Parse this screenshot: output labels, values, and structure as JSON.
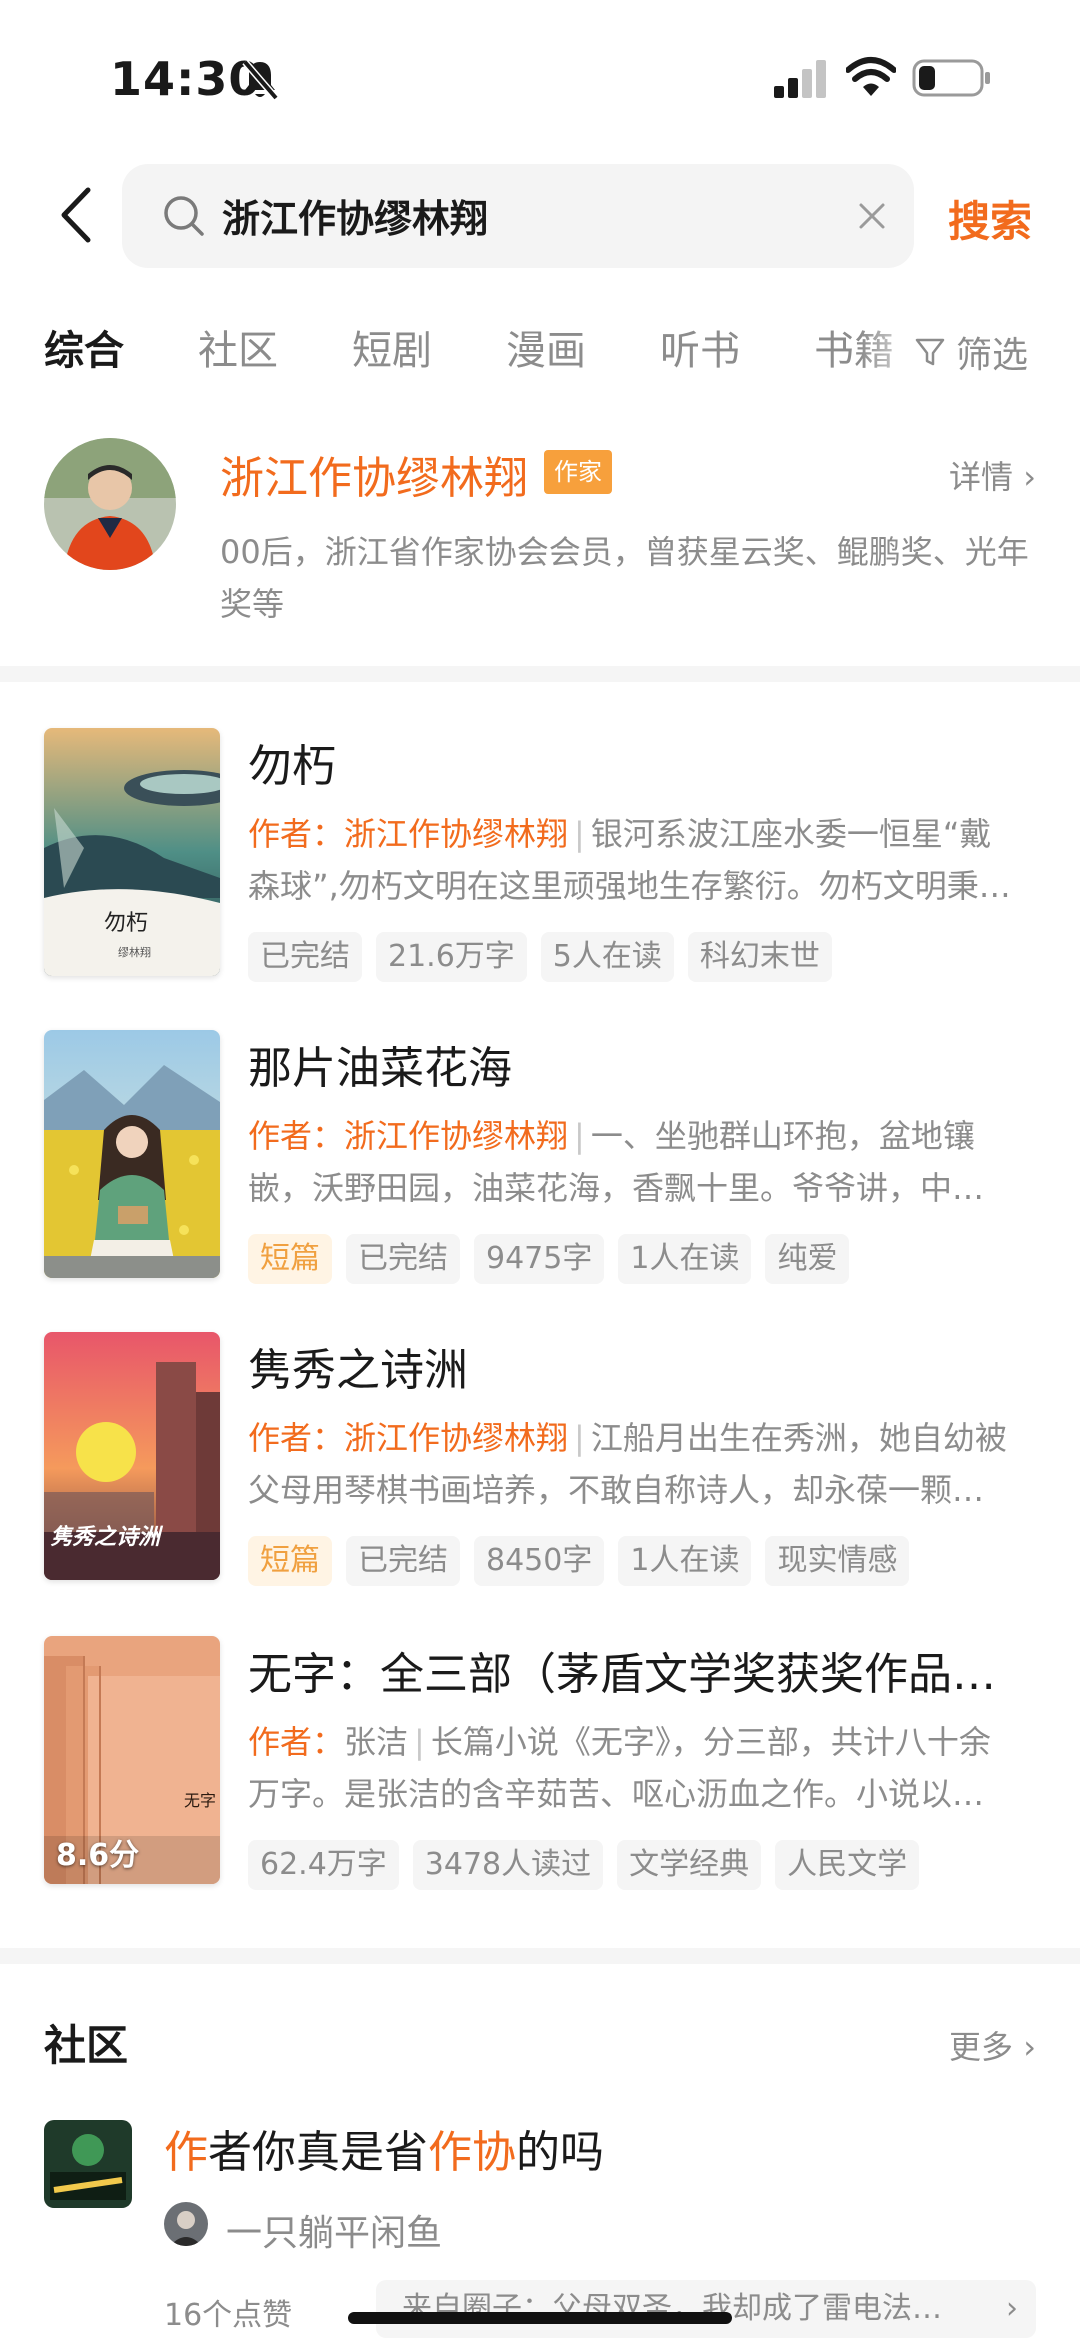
{
  "status_bar": {
    "time": "14:30"
  },
  "search": {
    "query": "浙江作协缪林翔",
    "button_label": "搜索"
  },
  "tabs": [
    {
      "label": "综合"
    },
    {
      "label": "社区"
    },
    {
      "label": "短剧"
    },
    {
      "label": "漫画"
    },
    {
      "label": "听书"
    },
    {
      "label": "书籍"
    }
  ],
  "filter_label": "筛选",
  "author": {
    "name": "浙江作协缪林翔",
    "tag": "作家",
    "detail_label": "详情",
    "description": "00后，浙江省作家协会会员，曾获星云奖、鲲鹏奖、光年奖等"
  },
  "books": [
    {
      "title": "勿朽",
      "author_prefix": "作者：",
      "author": "浙江作协缪林翔",
      "summary_line1": "银河系波江座水委一恒星“戴",
      "summary_line2": "森球”,勿朽文明在这里顽强地生存繁衍。勿朽文明秉…",
      "tags": [
        "已完结",
        "21.6万字",
        "5人在读",
        "科幻末世"
      ],
      "cover_text": "勿朽",
      "cover_sub": "缪林翔"
    },
    {
      "title": "那片油菜花海",
      "author_prefix": "作者：",
      "author": "浙江作协缪林翔",
      "summary_line1": "一、坐驰群山环抱，盆地镶",
      "summary_line2": "嵌，沃野田园，油菜花海，香飘十里。爷爷讲，中…",
      "highlight_tag": "短篇",
      "tags": [
        "已完结",
        "9475字",
        "1人在读",
        "纯爱"
      ]
    },
    {
      "title": "隽秀之诗洲",
      "author_prefix": "作者：",
      "author": "浙江作协缪林翔",
      "summary_line1": "江船月出生在秀洲，她自幼被",
      "summary_line2": "父母用琴棋书画培养，不敢自称诗人，却永葆一颗…",
      "highlight_tag": "短篇",
      "tags": [
        "已完结",
        "8450字",
        "1人在读",
        "现实情感"
      ],
      "cover_text": "隽秀之诗洲"
    },
    {
      "title": "无字：全三部（茅盾文学奖获奖作品…",
      "author_prefix": "作者：",
      "author": "张洁",
      "summary_line1": "长篇小说《无字》，分三部，共计八十余",
      "summary_line2": "万字。是张洁的含辛茹苦、呕心沥血之作。小说以…",
      "tags": [
        "62.4万字",
        "3478人读过",
        "文学经典",
        "人民文学"
      ],
      "rating": "8.6分",
      "cover_text": "无字"
    }
  ],
  "community": {
    "title": "社区",
    "more_label": "更多",
    "post": {
      "title_parts": [
        {
          "text": "作",
          "highlight": true
        },
        {
          "text": "者你真是省",
          "highlight": false
        },
        {
          "text": "作协",
          "highlight": true
        },
        {
          "text": "的吗",
          "highlight": false
        }
      ],
      "user": "一只躺平闲鱼",
      "likes": "16个点赞",
      "source": "来自圈子：父母双圣，我却成了雷电法…"
    }
  },
  "colors": {
    "accent": "#f26b1d",
    "tag_highlight": "#f0a040",
    "muted": "#8c8c8c"
  }
}
